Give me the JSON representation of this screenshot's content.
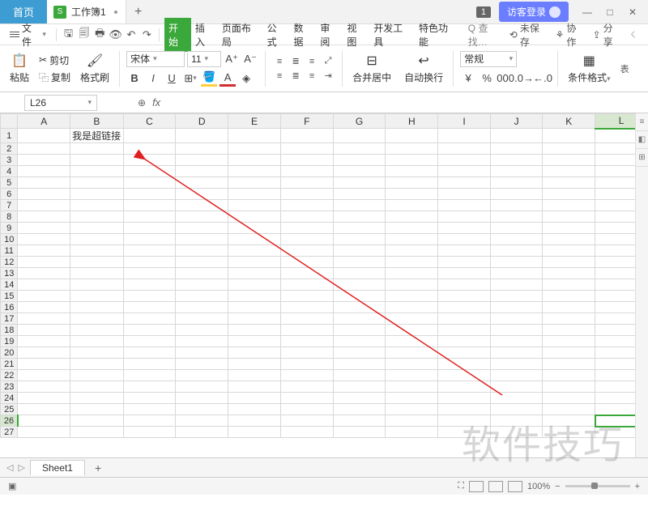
{
  "titlebar": {
    "home_tab": "首页",
    "workbook_tab": "工作簿1",
    "workbook_icon": "S",
    "badge": "1",
    "guest_login": "访客登录"
  },
  "menubar": {
    "file": "文件",
    "tabs": [
      "开始",
      "插入",
      "页面布局",
      "公式",
      "数据",
      "审阅",
      "视图",
      "开发工具",
      "特色功能"
    ],
    "search": "查找",
    "unsaved": "未保存",
    "collab": "协作",
    "share": "分享"
  },
  "ribbon": {
    "paste": "粘贴",
    "cut": "剪切",
    "copy": "复制",
    "format_painter": "格式刷",
    "font_name": "宋体",
    "font_size": "11",
    "merge_center": "合并居中",
    "wrap_text": "自动换行",
    "number_format": "常规",
    "cond_format": "条件格式",
    "table_extra": "表"
  },
  "formula": {
    "name_box": "L26",
    "fx": "fx"
  },
  "sheet": {
    "columns": [
      "A",
      "B",
      "C",
      "D",
      "E",
      "F",
      "G",
      "H",
      "I",
      "J",
      "K",
      "L"
    ],
    "rows": 27,
    "active_cell": "L26",
    "cells": {
      "B1": "我是超链接"
    }
  },
  "sheettabs": {
    "sheet1": "Sheet1"
  },
  "statusbar": {
    "zoom": "100%"
  },
  "watermark": "软件技巧"
}
